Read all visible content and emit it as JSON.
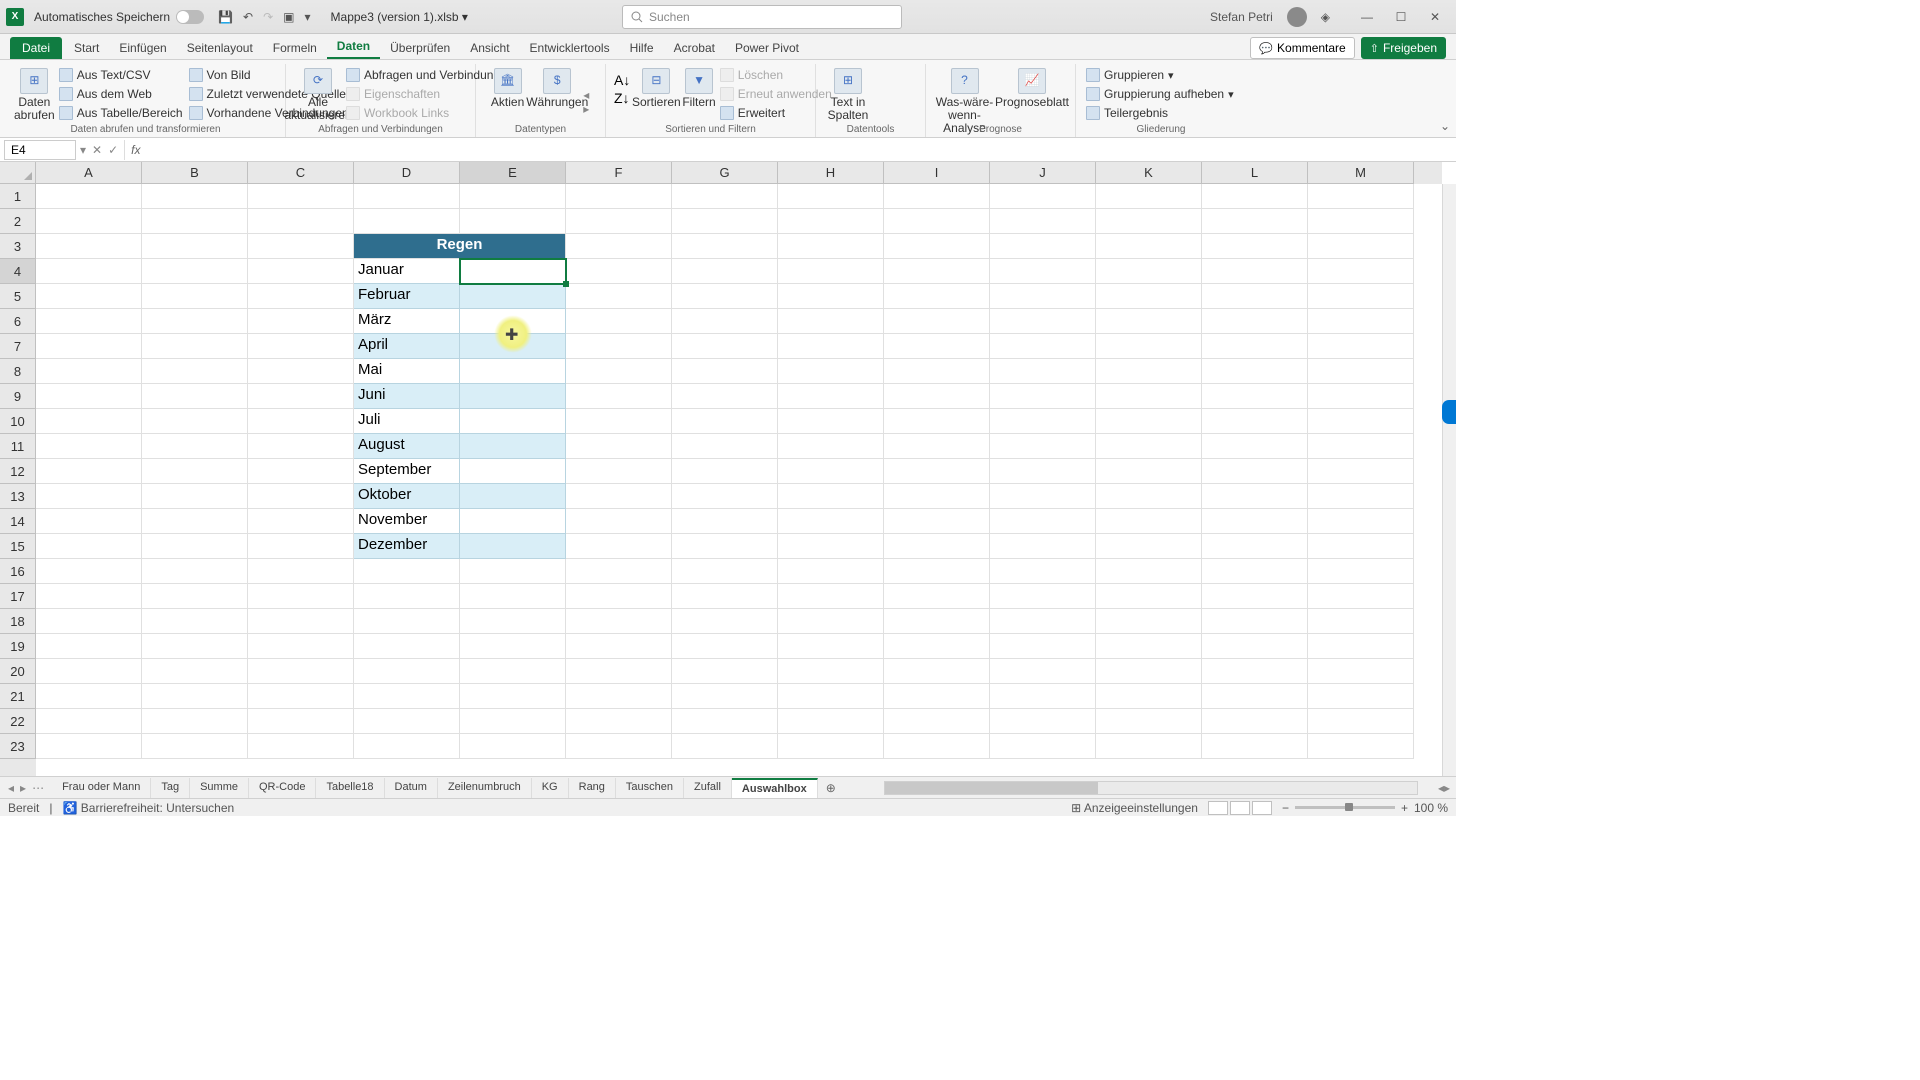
{
  "titlebar": {
    "autosave": "Automatisches Speichern",
    "filename": "Mappe3 (version 1).xlsb",
    "search_placeholder": "Suchen",
    "user": "Stefan Petri"
  },
  "tabs": {
    "file": "Datei",
    "start": "Start",
    "einfugen": "Einfügen",
    "seitenlayout": "Seitenlayout",
    "formeln": "Formeln",
    "daten": "Daten",
    "uberprufen": "Überprüfen",
    "ansicht": "Ansicht",
    "entwickler": "Entwicklertools",
    "hilfe": "Hilfe",
    "acrobat": "Acrobat",
    "powerpivot": "Power Pivot",
    "kommentare": "Kommentare",
    "freigeben": "Freigeben"
  },
  "ribbon": {
    "g1": {
      "label": "Daten abrufen und transformieren",
      "abrufen": "Daten abrufen",
      "textcsv": "Aus Text/CSV",
      "web": "Aus dem Web",
      "tabelle": "Aus Tabelle/Bereich",
      "bild": "Von Bild",
      "quellen": "Zuletzt verwendete Quellen",
      "verbind": "Vorhandene Verbindungen"
    },
    "g2": {
      "label": "Abfragen und Verbindungen",
      "aktual": "Alle aktualisieren",
      "abfverb": "Abfragen und Verbindungen",
      "eigen": "Eigenschaften",
      "links": "Workbook Links"
    },
    "g3": {
      "label": "Datentypen",
      "aktien": "Aktien",
      "wahr": "Währungen"
    },
    "g4": {
      "label": "Sortieren und Filtern",
      "sort": "Sortieren",
      "filt": "Filtern",
      "losch": "Löschen",
      "erneut": "Erneut anwenden",
      "erweit": "Erweitert"
    },
    "g5": {
      "label": "Datentools",
      "text": "Text in Spalten"
    },
    "g6": {
      "label": "Prognose",
      "wenn": "Was-wäre-wenn-Analyse",
      "blatt": "Prognoseblatt"
    },
    "g7": {
      "label": "Gliederung",
      "grp": "Gruppieren",
      "ungrp": "Gruppierung aufheben",
      "teil": "Teilergebnis"
    }
  },
  "namebox": "E4",
  "columns": [
    "A",
    "B",
    "C",
    "D",
    "E",
    "F",
    "G",
    "H",
    "I",
    "J",
    "K",
    "L",
    "M"
  ],
  "rows": [
    "1",
    "2",
    "3",
    "4",
    "5",
    "6",
    "7",
    "8",
    "9",
    "10",
    "11",
    "12",
    "13",
    "14",
    "15",
    "16",
    "17",
    "18",
    "19",
    "20",
    "21",
    "22",
    "23"
  ],
  "table": {
    "header": "Regen",
    "months": [
      "Januar",
      "Februar",
      "März",
      "April",
      "Mai",
      "Juni",
      "Juli",
      "August",
      "September",
      "Oktober",
      "November",
      "Dezember"
    ]
  },
  "sheettabs": [
    "Frau oder Mann",
    "Tag",
    "Summe",
    "QR-Code",
    "Tabelle18",
    "Datum",
    "Zeilenumbruch",
    "KG",
    "Rang",
    "Tauschen",
    "Zufall",
    "Auswahlbox"
  ],
  "status": {
    "ready": "Bereit",
    "access": "Barrierefreiheit: Untersuchen",
    "display": "Anzeigeeinstellungen",
    "zoom": "100 %"
  }
}
